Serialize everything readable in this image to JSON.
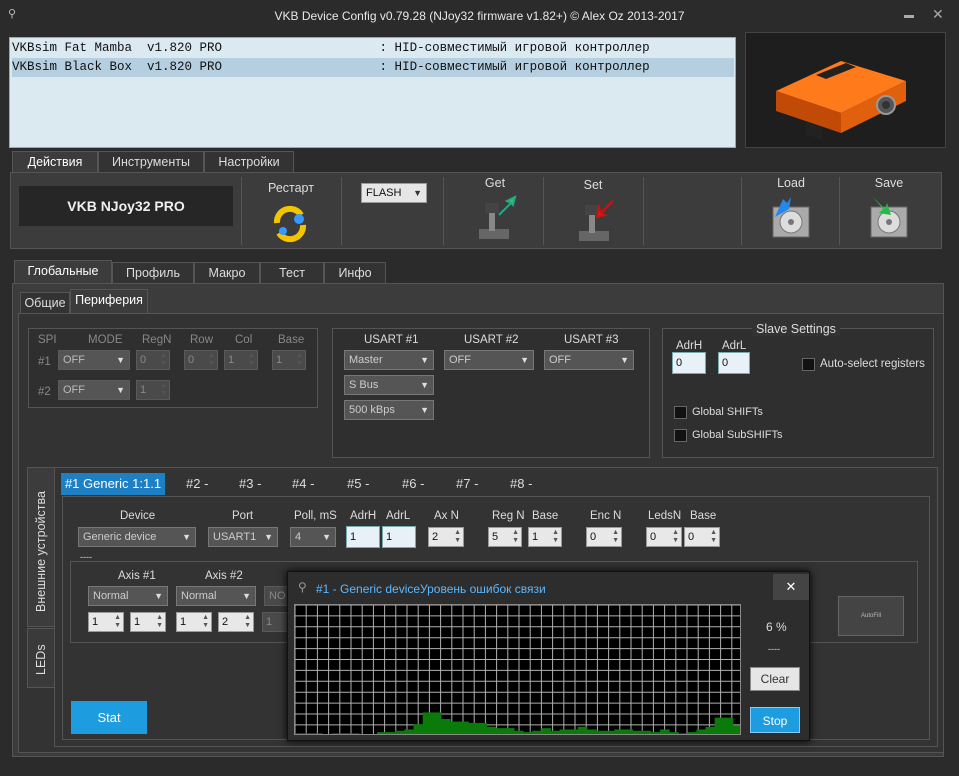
{
  "window": {
    "title": "VKB Device Config v0.79.28 (NJoy32 firmware v1.82+) © Alex Oz 2013-2017",
    "minimize": "▬",
    "close": "✕"
  },
  "devices": [
    {
      "text": "VKBsim Fat Mamba  v1.820 PRO                     : HID-совместимый игровой контроллер",
      "selected": false
    },
    {
      "text": "VKBsim Black Box  v1.820 PRO                     : HID-совместимый игровой контроллер",
      "selected": true
    }
  ],
  "top_tabs": [
    "Действия",
    "Инструменты",
    "Настройки"
  ],
  "toolbar": {
    "brand": "VKB NJoy32 PRO",
    "restart": "Рестарт",
    "flash_select": "FLASH",
    "get": "Get",
    "set": "Set",
    "load": "Load",
    "save": "Save"
  },
  "main_tabs": [
    "Глобальные",
    "Профиль",
    "Макро",
    "Тест",
    "Инфо"
  ],
  "sub_tabs": [
    "Общие",
    "Периферия"
  ],
  "spi": {
    "label": "SPI",
    "mode": "MODE",
    "regn": "RegN",
    "row": "Row",
    "col": "Col",
    "base": "Base",
    "row1": "#1",
    "row2": "#2",
    "mode1": "OFF",
    "mode2": "OFF",
    "val0": "0",
    "val1": "1"
  },
  "usart": {
    "u1": "USART #1",
    "u2": "USART #2",
    "u3": "USART #3",
    "u1_mode": "Master",
    "u1_proto": "S Bus",
    "u1_speed": "500 kBps",
    "u2_mode": "OFF",
    "u3_mode": "OFF"
  },
  "slave": {
    "title": "Slave Settings",
    "adrh": "AdrH",
    "adrl": "AdrL",
    "adrh_val": "0",
    "adrl_val": "0",
    "auto_select": "Auto-select registers",
    "global_shifts": "Global SHIFTs",
    "global_subshifts": "Global SubSHIFTs"
  },
  "side_tabs": [
    "Внешние устройства",
    "LEDs"
  ],
  "ext_tabs": [
    "#1 Generic 1:1.1",
    "#2 -",
    "#3 -",
    "#4 -",
    "#5 -",
    "#6 -",
    "#7 -",
    "#8 -"
  ],
  "device_row": {
    "device": "Device",
    "port": "Port",
    "poll": "Poll, mS",
    "adrh": "AdrH",
    "adrl": "AdrL",
    "axn": "Ax N",
    "regn": "Reg N",
    "base": "Base",
    "encn": "Enc N",
    "ledsn": "LedsN",
    "base2": "Base",
    "device_val": "Generic device",
    "port_val": "USART1",
    "poll_val": "4",
    "adrh_val": "1",
    "adrl_val": "1",
    "axn_val": "2",
    "regn_val": "5",
    "base_val": "1",
    "encn_val": "0",
    "ledsn_val": "0",
    "base2_val": "0",
    "dash": "----"
  },
  "axes": {
    "axis1": "Axis #1",
    "axis2": "Axis #2",
    "mode1": "Normal",
    "mode2": "Normal",
    "mode3": "NO",
    "a1v1": "1",
    "a1v2": "1",
    "a2v1": "1",
    "a2v2": "2",
    "a3v1": "1",
    "autofill": "AutoFill"
  },
  "stat_button": "Stat",
  "popup": {
    "title": "#1 - Generic deviceУровень ошибок связи",
    "close": "✕",
    "percent": "6 %",
    "dash": "----",
    "clear": "Clear",
    "stop": "Stop",
    "error_levels": [
      2,
      2,
      2,
      1,
      2,
      2,
      2,
      1,
      1,
      3,
      3,
      4,
      5,
      9,
      18,
      18,
      13,
      11,
      11,
      10,
      10,
      7,
      6,
      6,
      4,
      3,
      4,
      6,
      4,
      5,
      5,
      7,
      5,
      4,
      4,
      5,
      5,
      4,
      4,
      3,
      5,
      3,
      2,
      3,
      5,
      7,
      14,
      14,
      8
    ]
  },
  "colors": {
    "accent": "#1d9de0",
    "graph_fill": "#0a7a0a",
    "graph_grid": "#b0b0b0"
  }
}
